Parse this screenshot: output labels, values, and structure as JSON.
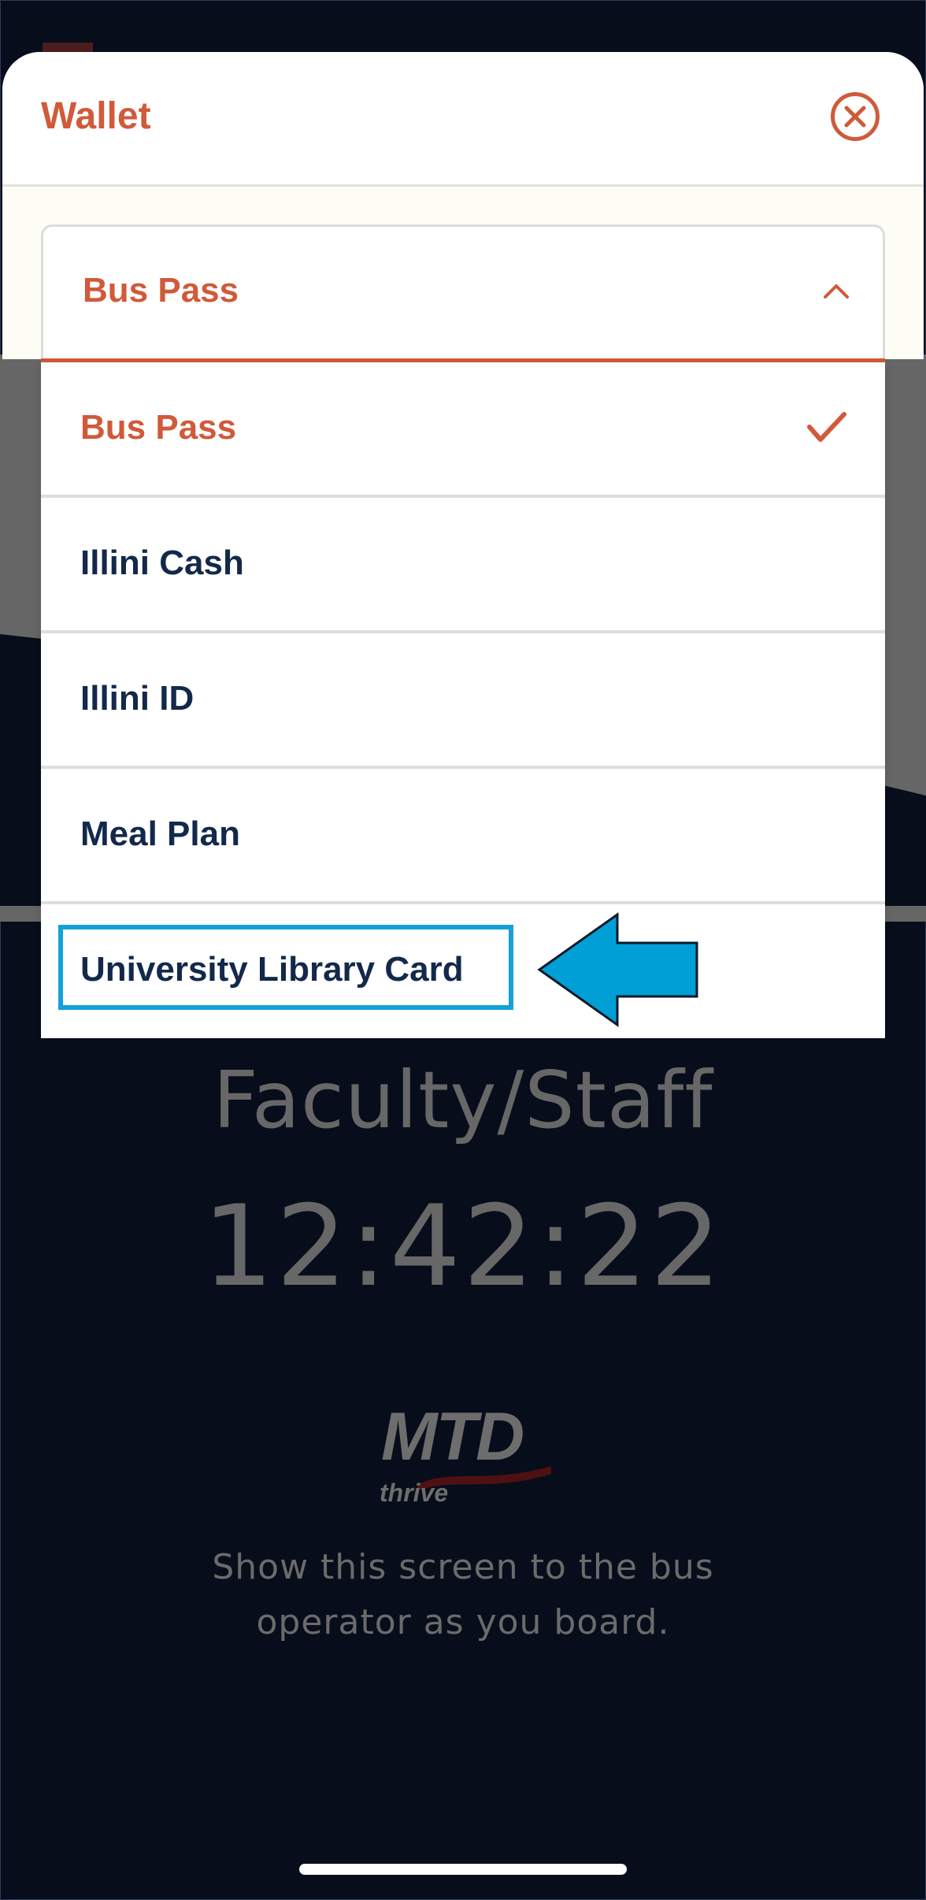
{
  "background": {
    "pass_type": "Faculty/Staff",
    "time": "12:42:22",
    "logo": {
      "main": "MTD",
      "sub": "thrive",
      "icon": "mtd-logo-icon"
    },
    "instructions_line1": "Show this screen to the bus",
    "instructions_line2": "operator as you board."
  },
  "sheet": {
    "title": "Wallet",
    "close_icon": "close-circle-icon",
    "select": {
      "value": "Bus Pass",
      "icon": "chevron-up-icon",
      "options": [
        {
          "label": "Bus Pass",
          "selected": true,
          "icon": "checkmark-icon"
        },
        {
          "label": "Illini Cash",
          "selected": false
        },
        {
          "label": "Illini ID",
          "selected": false
        },
        {
          "label": "Meal Plan",
          "selected": false
        },
        {
          "label": "University Library Card",
          "selected": false
        }
      ]
    }
  },
  "annotation": {
    "icon": "left-arrow-icon",
    "color": "#009fd6"
  },
  "colors": {
    "accent": "#d05a3a",
    "text_dark": "#13294b",
    "background": "#070d1a"
  }
}
